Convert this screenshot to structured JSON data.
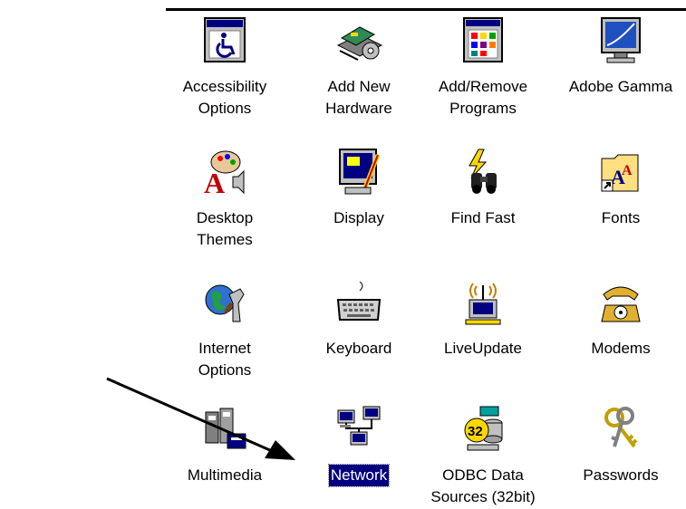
{
  "window": {
    "title": ""
  },
  "items": [
    {
      "label": "Accessibility\nOptions",
      "icon": "accessibility-icon"
    },
    {
      "label": "Add New\nHardware",
      "icon": "add-hardware-icon"
    },
    {
      "label": "Add/Remove\nPrograms",
      "icon": "add-remove-programs-icon"
    },
    {
      "label": "Adobe Gamma",
      "icon": "adobe-gamma-icon"
    },
    {
      "label": "Desktop\nThemes",
      "icon": "desktop-themes-icon"
    },
    {
      "label": "Display",
      "icon": "display-icon"
    },
    {
      "label": "Find Fast",
      "icon": "find-fast-icon"
    },
    {
      "label": "Fonts",
      "icon": "fonts-folder-icon"
    },
    {
      "label": "Internet\nOptions",
      "icon": "internet-options-icon"
    },
    {
      "label": "Keyboard",
      "icon": "keyboard-icon"
    },
    {
      "label": "LiveUpdate",
      "icon": "liveupdate-icon"
    },
    {
      "label": "Modems",
      "icon": "modem-phone-icon"
    },
    {
      "label": "Multimedia",
      "icon": "multimedia-icon"
    },
    {
      "label": "Network",
      "icon": "network-icon",
      "selected": true
    },
    {
      "label": "ODBC Data\nSources (32bit)",
      "icon": "odbc-icon"
    },
    {
      "label": "Passwords",
      "icon": "passwords-keys-icon"
    }
  ],
  "colors": {
    "selection": "#000080",
    "selection_text": "#ffffff"
  }
}
